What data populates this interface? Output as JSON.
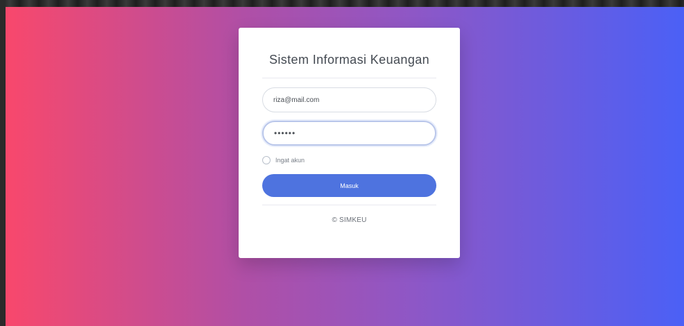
{
  "app": {
    "title": "Sistem Informasi Keuangan",
    "footer_text": "© SIMKEU"
  },
  "form": {
    "email_value": "riza@mail.com",
    "password_value": "••••••",
    "remember_label": "Ingat akun",
    "submit_label": "Masuk"
  },
  "colors": {
    "gradient_start": "#f8486c",
    "gradient_end": "#4b60f6",
    "button": "#4e73df"
  }
}
